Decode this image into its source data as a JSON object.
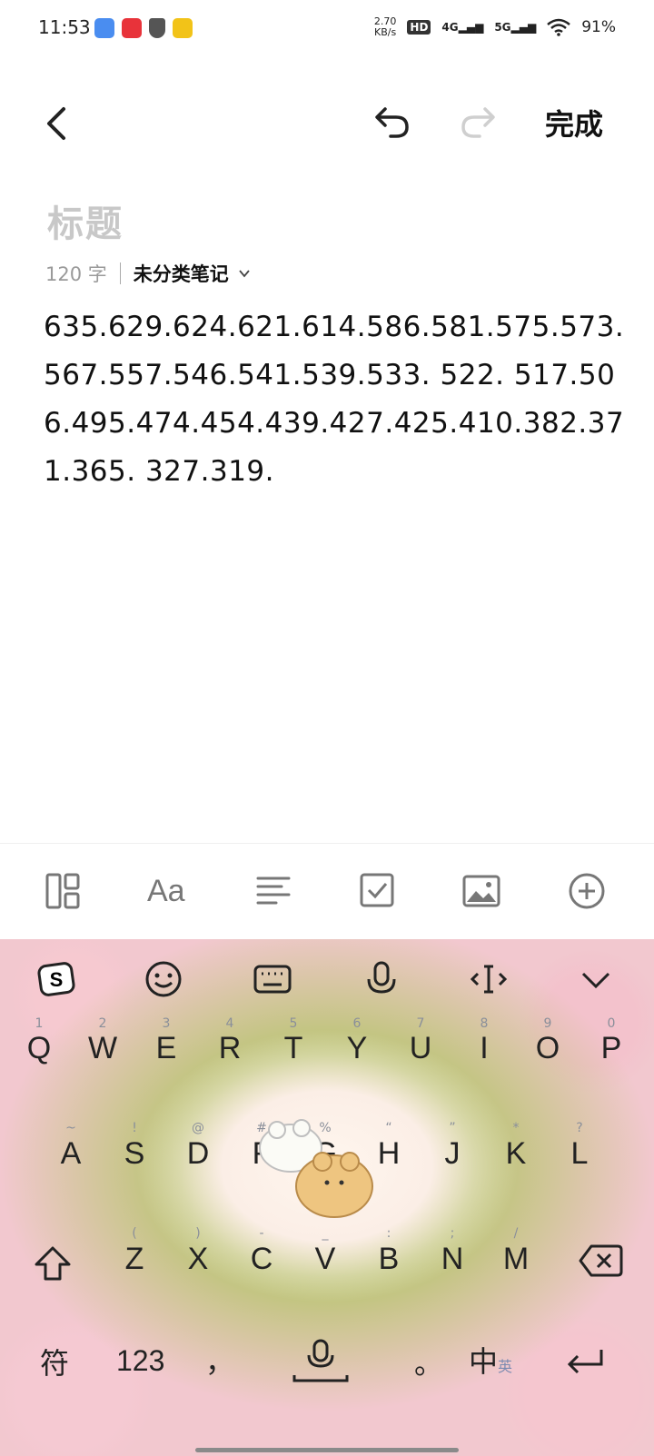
{
  "status_bar": {
    "time": "11:53",
    "net_speed_value": "2.70",
    "net_speed_unit": "KB/s",
    "hd": "HD",
    "sim1": "4G",
    "sim2": "5G",
    "battery": "91%"
  },
  "toolbar": {
    "done_label": "完成"
  },
  "note": {
    "title_placeholder": "标题",
    "char_count": "120 字",
    "category": "未分类笔记",
    "body": "635.629.624.621.614.586.581.575.573.567.557.546.541.539.533. 522. 517.506.495.474.454.439.427.425.410.382.371.365. 327.319."
  },
  "keyboard": {
    "row1": [
      "Q",
      "W",
      "E",
      "R",
      "T",
      "Y",
      "U",
      "I",
      "O",
      "P"
    ],
    "row1_hints": [
      "1",
      "2",
      "3",
      "4",
      "5",
      "6",
      "7",
      "8",
      "9",
      "0"
    ],
    "row2": [
      "A",
      "S",
      "D",
      "F",
      "G",
      "H",
      "J",
      "K",
      "L"
    ],
    "row2_hints": [
      "~",
      "!",
      "@",
      "#",
      "%",
      "“",
      "”",
      "*",
      "?"
    ],
    "row3": [
      "Z",
      "X",
      "C",
      "V",
      "B",
      "N",
      "M"
    ],
    "row3_hints": [
      "(",
      ")",
      "-",
      "_",
      ":",
      ";",
      "/"
    ],
    "symbols_label": "符",
    "numbers_label": "123",
    "comma_label": "，",
    "period_label": "。",
    "lang_label": "中",
    "lang_sub_label": "英"
  },
  "colors": {
    "accent_red": "#e8333a",
    "text": "#111111",
    "placeholder": "#c8c8c8"
  }
}
